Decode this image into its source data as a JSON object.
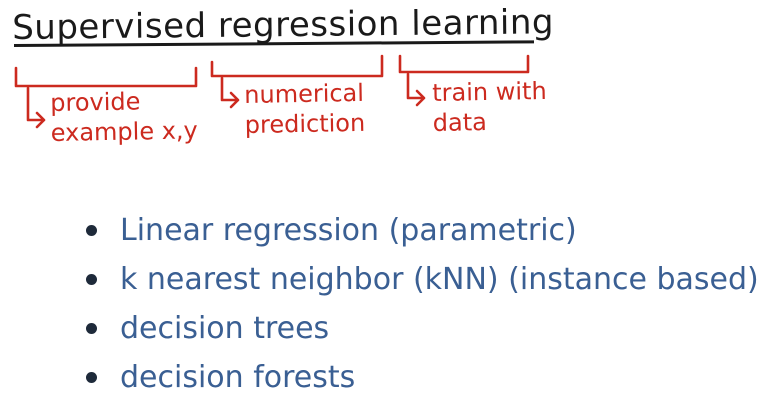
{
  "title": "Supervised regression learning",
  "annotations": [
    {
      "lines": [
        "provide",
        "example x,y"
      ]
    },
    {
      "lines": [
        "numerical",
        "prediction"
      ]
    },
    {
      "lines": [
        "train with",
        "data"
      ]
    }
  ],
  "bullets": [
    "Linear regression (parametric)",
    "k nearest neighbor (kNN) (instance based)",
    "decision trees",
    "decision forests"
  ],
  "colors": {
    "title_ink": "#1a1a1a",
    "annotation_ink": "#cc2a1f",
    "bullet_ink": "#3a5f93"
  }
}
